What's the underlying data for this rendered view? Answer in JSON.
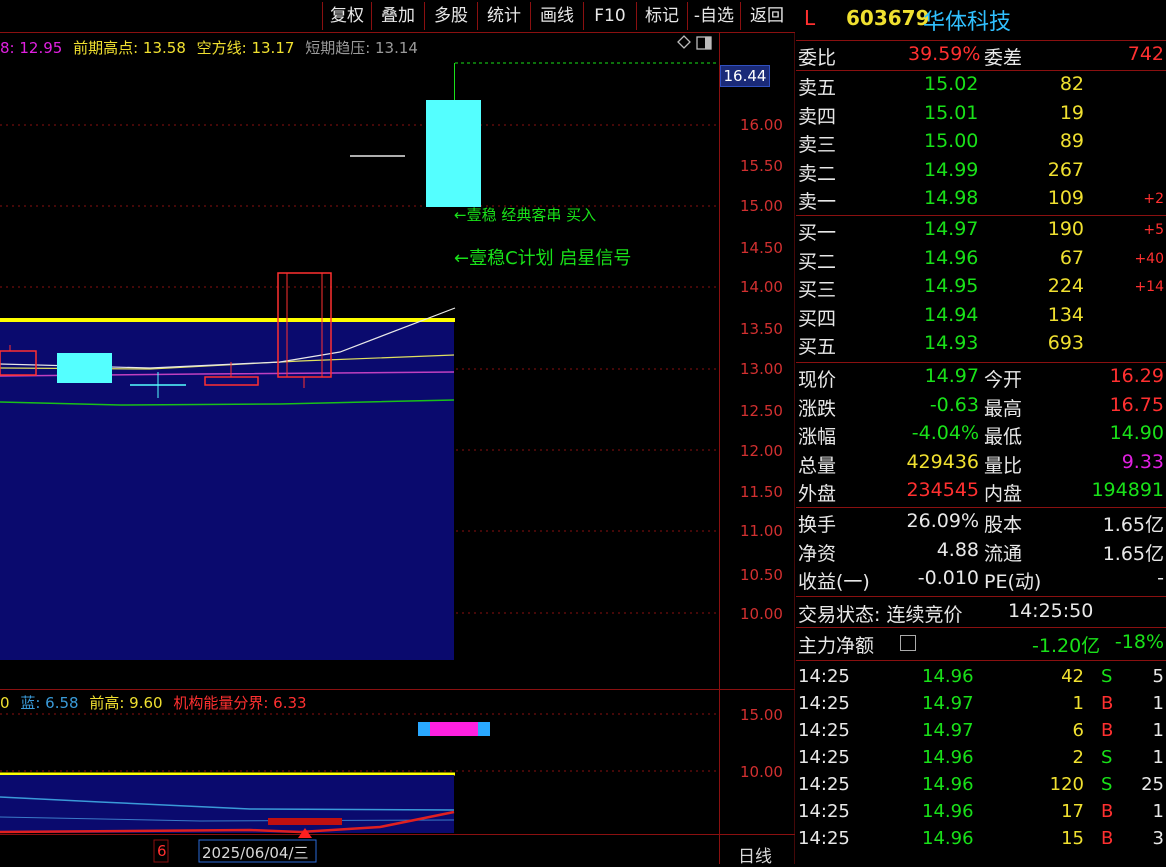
{
  "toolbar": {
    "buttons": [
      "复权",
      "叠加",
      "多股",
      "统计",
      "画线",
      "F10",
      "标记",
      "-自选",
      "返回"
    ]
  },
  "indicator_main": {
    "partial_label": "8: 12.95",
    "prev_high": "前期高点: 13.58",
    "bear_line": "空方线: 13.17",
    "short_pressure": "短期趋压: 13.14"
  },
  "price_marker": "16.44",
  "price_axis": [
    "16.00",
    "15.50",
    "15.00",
    "14.50",
    "14.00",
    "13.50",
    "13.00",
    "12.50",
    "12.00",
    "11.50",
    "11.00",
    "10.50",
    "10.00"
  ],
  "signals": {
    "line1": "←壹稳 经典客串 买入",
    "line2": "←壹稳C计划 启星信号"
  },
  "indicator_sub": {
    "partial_label": "0",
    "blue": "蓝: 6.58",
    "prev_high": "前高: 9.60",
    "inst_line": "机构能量分界: 6.33"
  },
  "sub_axis": [
    "15.00",
    "10.00"
  ],
  "bottom": {
    "left_num": "6",
    "date": "2025/06/04/三",
    "period": "日线"
  },
  "stock": {
    "flag": "L",
    "code": "603679",
    "name": "华体科技"
  },
  "order_ratio": {
    "label": "委比",
    "value": "39.59%",
    "diff_label": "委差",
    "diff": "742"
  },
  "asks": [
    {
      "label": "卖五",
      "price": "15.02",
      "vol": "82",
      "chg": ""
    },
    {
      "label": "卖四",
      "price": "15.01",
      "vol": "19",
      "chg": ""
    },
    {
      "label": "卖三",
      "price": "15.00",
      "vol": "89",
      "chg": ""
    },
    {
      "label": "卖二",
      "price": "14.99",
      "vol": "267",
      "chg": ""
    },
    {
      "label": "卖一",
      "price": "14.98",
      "vol": "109",
      "chg": "+2"
    }
  ],
  "bids": [
    {
      "label": "买一",
      "price": "14.97",
      "vol": "190",
      "chg": "+5"
    },
    {
      "label": "买二",
      "price": "14.96",
      "vol": "67",
      "chg": "+40"
    },
    {
      "label": "买三",
      "price": "14.95",
      "vol": "224",
      "chg": "+14"
    },
    {
      "label": "买四",
      "price": "14.94",
      "vol": "134",
      "chg": ""
    },
    {
      "label": "买五",
      "price": "14.93",
      "vol": "693",
      "chg": ""
    }
  ],
  "quote": [
    {
      "l1": "现价",
      "v1": "14.97",
      "l2": "今开",
      "v2": "16.29"
    },
    {
      "l1": "涨跌",
      "v1": "-0.63",
      "l2": "最高",
      "v2": "16.75"
    },
    {
      "l1": "涨幅",
      "v1": "-4.04%",
      "l2": "最低",
      "v2": "14.90"
    },
    {
      "l1": "总量",
      "v1": "429436",
      "l2": "量比",
      "v2": "9.33"
    },
    {
      "l1": "外盘",
      "v1": "234545",
      "l2": "内盘",
      "v2": "194891"
    }
  ],
  "fund": [
    {
      "l1": "换手",
      "v1": "26.09%",
      "l2": "股本",
      "v2": "1.65亿"
    },
    {
      "l1": "净资",
      "v1": "4.88",
      "l2": "流通",
      "v2": "1.65亿"
    },
    {
      "l1": "收益(一)",
      "v1": "-0.010",
      "l2": "PE(动)",
      "v2": "-"
    }
  ],
  "status": {
    "label": "交易状态: 连续竞价",
    "time": "14:25:50"
  },
  "main_flow": {
    "label": "主力净额",
    "value": "-1.20亿",
    "pct": "-18%"
  },
  "ticks": [
    {
      "time": "14:25",
      "price": "14.96",
      "vol": "42",
      "side": "S",
      "n": "5"
    },
    {
      "time": "14:25",
      "price": "14.97",
      "vol": "1",
      "side": "B",
      "n": "1"
    },
    {
      "time": "14:25",
      "price": "14.97",
      "vol": "6",
      "side": "B",
      "n": "1"
    },
    {
      "time": "14:25",
      "price": "14.96",
      "vol": "2",
      "side": "S",
      "n": "1"
    },
    {
      "time": "14:25",
      "price": "14.96",
      "vol": "120",
      "side": "S",
      "n": "25"
    },
    {
      "time": "14:25",
      "price": "14.96",
      "vol": "17",
      "side": "B",
      "n": "1"
    },
    {
      "time": "14:25",
      "price": "14.96",
      "vol": "15",
      "side": "B",
      "n": "3"
    }
  ],
  "colors": {
    "up": "#ff3030",
    "down": "#19e119",
    "candle_down": "#54ffff",
    "bg_fill": "#0a0a6e",
    "grid": "#8a1010"
  }
}
